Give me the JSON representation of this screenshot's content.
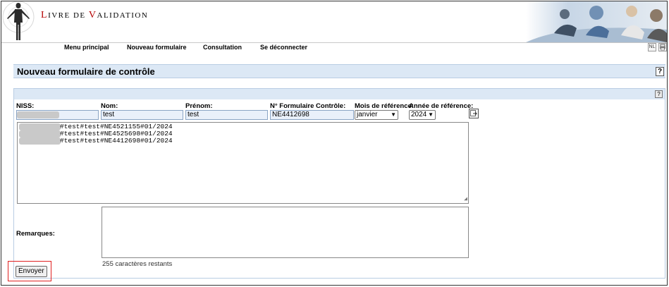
{
  "app": {
    "title_cap1": "L",
    "title_rest1": "ivre de ",
    "title_cap2": "V",
    "title_rest2": "alidation"
  },
  "nav": {
    "items": [
      "Menu principal",
      "Nouveau formulaire",
      "Consultation",
      "Se déconnecter"
    ],
    "lang_label": "NL"
  },
  "page": {
    "title": "Nouveau formulaire de contrôle",
    "help_label": "?"
  },
  "form": {
    "labels": {
      "niss": "NISS:",
      "nom": "Nom:",
      "prenom": "Prénom:",
      "formulaire": "N° Formulaire Contrôle:",
      "mois": "Mois de référence:",
      "annee": "Année de référence:",
      "remarques": "Remarques:"
    },
    "values": {
      "niss": "",
      "nom": "test",
      "prenom": "test",
      "formulaire": "NE4412698",
      "mois": "janvier",
      "annee": "2024"
    },
    "lines": [
      "#test#test#NE4521155#01/2024",
      "#test#test#NE4525698#01/2024",
      "#test#test#NE4412698#01/2024"
    ],
    "remarques_value": "",
    "counter": "255 caractères restants",
    "send_label": "Envoyer"
  },
  "colors": {
    "bar_bg": "#dce8f5",
    "accent_red": "#b40000",
    "highlight": "#e02020"
  }
}
